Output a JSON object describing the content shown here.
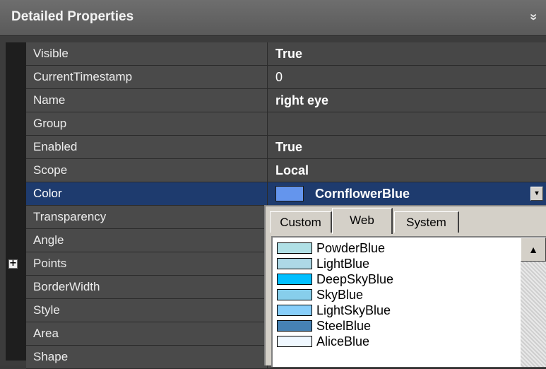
{
  "header": {
    "title": "Detailed Properties",
    "collapse_glyph": "»"
  },
  "properties": [
    {
      "name": "Visible",
      "value": "True"
    },
    {
      "name": "CurrentTimestamp",
      "value": "0"
    },
    {
      "name": "Name",
      "value": "right eye"
    },
    {
      "name": "Group",
      "value": ""
    },
    {
      "name": "Enabled",
      "value": "True"
    },
    {
      "name": "Scope",
      "value": "Local"
    },
    {
      "name": "Color",
      "value": "CornflowerBlue",
      "swatch": "#6495ED",
      "selected": true
    },
    {
      "name": "Transparency",
      "value": ""
    },
    {
      "name": "Angle",
      "value": ""
    },
    {
      "name": "Points",
      "value": "",
      "expandable": true,
      "expander_glyph": "+"
    },
    {
      "name": "BorderWidth",
      "value": ""
    },
    {
      "name": "Style",
      "value": ""
    },
    {
      "name": "Area",
      "value": ""
    },
    {
      "name": "Shape",
      "value": ""
    }
  ],
  "color_dropdown": {
    "button_glyph": "▾",
    "tabs": [
      {
        "label": "Custom",
        "active": false
      },
      {
        "label": "Web",
        "active": true
      },
      {
        "label": "System",
        "active": false
      }
    ],
    "colors": [
      {
        "name": "PowderBlue",
        "hex": "#B0E0E6"
      },
      {
        "name": "LightBlue",
        "hex": "#ADD8E6"
      },
      {
        "name": "DeepSkyBlue",
        "hex": "#00BFFF"
      },
      {
        "name": "SkyBlue",
        "hex": "#87CEEB"
      },
      {
        "name": "LightSkyBlue",
        "hex": "#87CEFA"
      },
      {
        "name": "SteelBlue",
        "hex": "#4682B4"
      },
      {
        "name": "AliceBlue",
        "hex": "#F0F8FF"
      }
    ],
    "scroll_up_glyph": "▲"
  }
}
